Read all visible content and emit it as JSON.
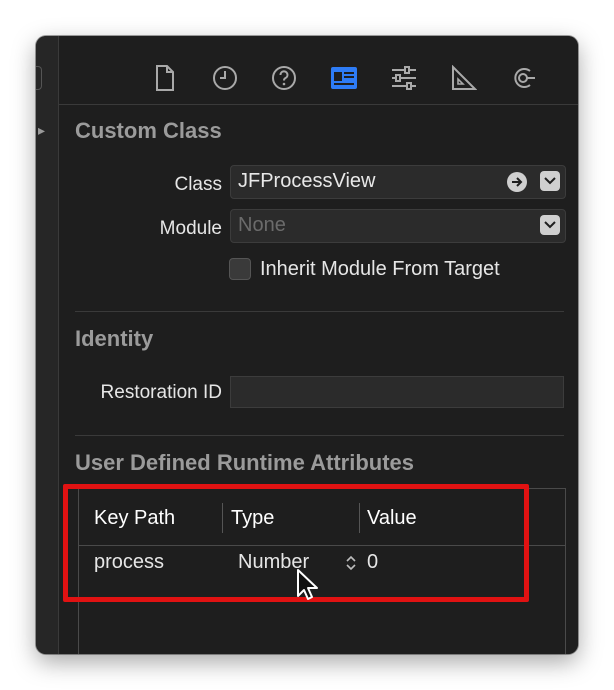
{
  "icons": {
    "tabs": [
      "file-icon",
      "history-icon",
      "help-icon",
      "identity-inspector-icon",
      "attributes-sliders-icon",
      "size-ruler-icon",
      "connections-icon"
    ],
    "active_tab": "identity-inspector-icon",
    "accent": "#2e7cf6"
  },
  "custom_class": {
    "title": "Custom Class",
    "class_label": "Class",
    "class_value": "JFProcessView",
    "module_label": "Module",
    "module_placeholder": "None",
    "inherit_label": "Inherit Module From Target",
    "inherit_checked": false
  },
  "identity": {
    "title": "Identity",
    "restoration_label": "Restoration ID",
    "restoration_value": ""
  },
  "runtime": {
    "title": "User Defined Runtime Attributes",
    "columns": [
      "Key Path",
      "Type",
      "Value"
    ],
    "rows": [
      {
        "key_path": "process",
        "type": "Number",
        "value": "0"
      }
    ]
  },
  "highlight_color": "#e11212"
}
